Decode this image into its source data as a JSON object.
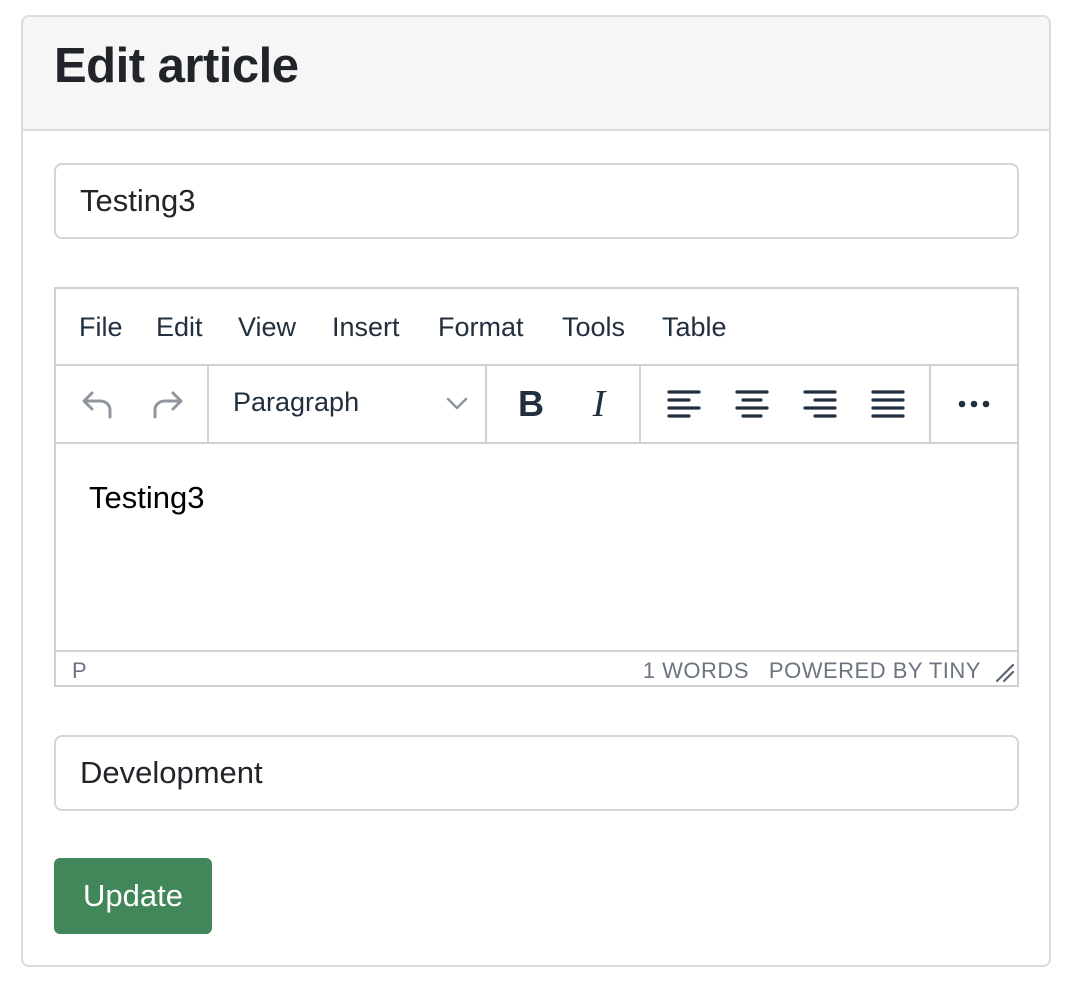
{
  "page": {
    "title": "Edit article"
  },
  "form": {
    "title_value": "Testing3",
    "category_value": "Development",
    "submit_label": "Update"
  },
  "editor": {
    "menu": [
      "File",
      "Edit",
      "View",
      "Insert",
      "Format",
      "Tools",
      "Table"
    ],
    "block_format": "Paragraph",
    "content": "Testing3",
    "status_path": "P",
    "word_count": "1 WORDS",
    "branding": "POWERED BY TINY",
    "icons": [
      "undo-icon",
      "redo-icon",
      "chevron-down-icon",
      "bold-icon",
      "italic-icon",
      "align-left-icon",
      "align-center-icon",
      "align-right-icon",
      "align-justify-icon",
      "more-icon",
      "resize-handle-icon"
    ]
  },
  "colors": {
    "primary_button": "#428759",
    "header_bg": "#f6f6f6",
    "border": "#dcdcdc",
    "icon_disabled": "#8f969d",
    "icon": "#222f3e"
  }
}
